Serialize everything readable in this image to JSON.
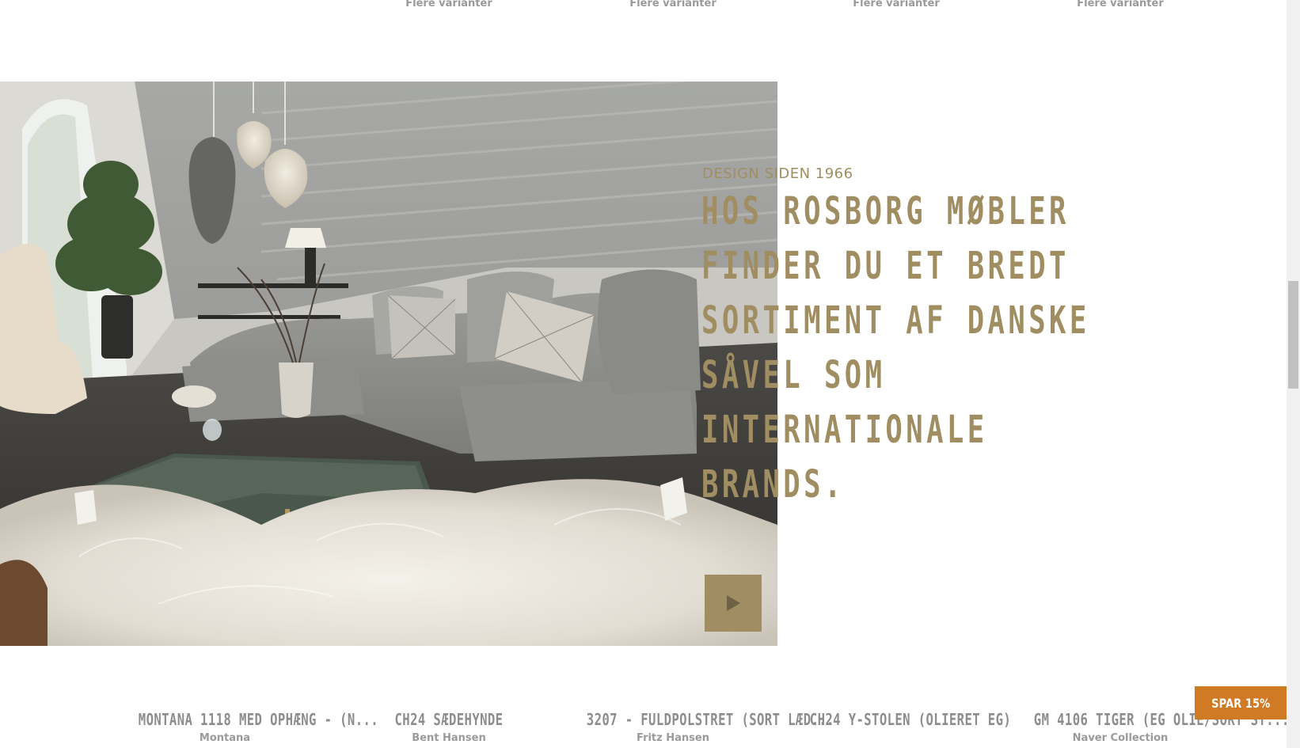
{
  "top_row": {
    "variant_links": [
      "Flere varianter",
      "Flere varianter",
      "Flere varianter",
      "Flere varianter"
    ]
  },
  "hero": {
    "eyebrow": "DESIGN SIDEN 1966",
    "headline": "HOS ROSBORG MØBLER FINDER DU ET BREDT SORTIMENT AF DANSKE SÅVEL SOM INTERNATIONALE BRANDS.",
    "play_icon": "play-icon",
    "accent_color": "#a08e62"
  },
  "products": [
    {
      "name": "MONTANA 1118 MED OPHÆNG - (N...",
      "brand": "Montana"
    },
    {
      "name": "CH24 SÆDEHYNDE",
      "brand": "Bent Hansen"
    },
    {
      "name": "3207 - FULDPOLSTRET (SORT LÆD...",
      "brand": "Fritz Hansen"
    },
    {
      "name": "CH24 Y-STOLEN (OLIERET EG)",
      "brand": ""
    },
    {
      "name": "GM 4106 TIGER (EG OLIE/SORT ST...",
      "brand": "Naver Collection"
    }
  ],
  "promo": {
    "label": "SPAR 15%",
    "color": "#d17a26"
  }
}
